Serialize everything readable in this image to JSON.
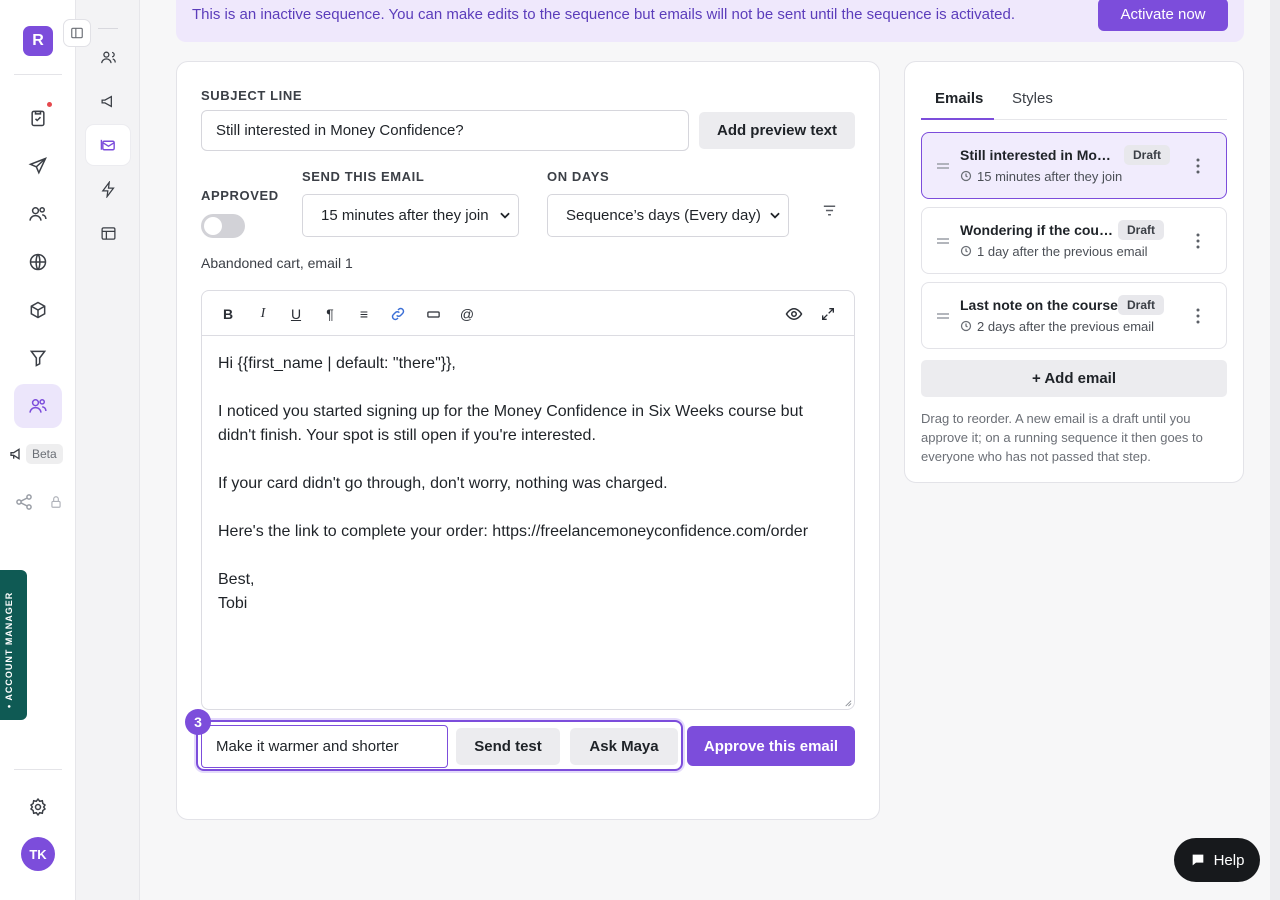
{
  "rail": {
    "logo_letter": "R",
    "beta_label": "Beta",
    "account_manager_label": "• ACCOUNT MANAGER",
    "avatar_initials": "TK"
  },
  "banner": {
    "text": "This is an inactive sequence. You can make edits to the sequence but emails will not be sent until the sequence is activated.",
    "activate_label": "Activate now"
  },
  "editor": {
    "subject_label": "SUBJECT LINE",
    "subject_value": "Still interested in Money Confidence?",
    "add_preview_label": "Add preview text",
    "approved_label": "APPROVED",
    "send_label": "SEND THIS EMAIL",
    "send_value": "15 minutes after they join",
    "days_label": "ON DAYS",
    "days_value": "Sequence’s days (Every day)",
    "caption": "Abandoned cart, email 1",
    "body": [
      "Hi {{first_name | default: \"there\"}},",
      "",
      "I noticed you started signing up for the Money Confidence in Six Weeks course but didn't finish. Your spot is still open if you're interested.",
      "",
      "If your card didn't go through, don't worry, nothing was charged.",
      "",
      "Here's the link to complete your order: https://freelancemoneyconfidence.com/order",
      "",
      "Best,",
      "Tobi"
    ],
    "ai_prompt_value": "Make it warmer and shorter",
    "step_badge": "3",
    "send_test_label": "Send test",
    "ask_maya_label": "Ask Maya",
    "approve_label": "Approve this email"
  },
  "emails_panel": {
    "tabs": [
      "Emails",
      "Styles"
    ],
    "items": [
      {
        "title": "Still interested in Mon…",
        "badge": "Draft",
        "timing": "15 minutes after they join"
      },
      {
        "title": "Wondering if the cour…",
        "badge": "Draft",
        "timing": "1 day after the previous email"
      },
      {
        "title": "Last note on the course",
        "badge": "Draft",
        "timing": "2 days after the previous email"
      }
    ],
    "add_label": "+ Add email",
    "help_text": "Drag to reorder. A new email is a draft until you approve it; on a running sequence it then goes to everyone who has not passed that step."
  },
  "help_button_label": "Help",
  "colors": {
    "accent": "#7c4ddb",
    "banner_bg": "#efe8fc",
    "account_tab": "#0f5a54"
  }
}
